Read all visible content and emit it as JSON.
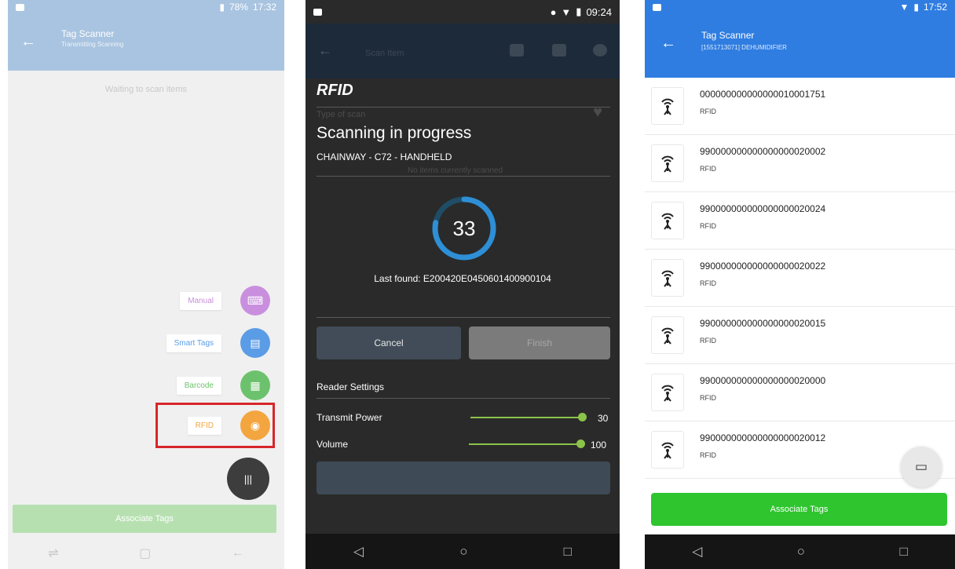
{
  "colors": {
    "p1_header": "#a9c4e0",
    "p3_header": "#2f7de1",
    "green": "#2ec52e",
    "slider": "#8bc34a",
    "highlight": "#d7262b",
    "manual": "#c98fde",
    "smart_tags": "#5b9ce6",
    "barcode": "#6cc26c",
    "rfid": "#f3a53f"
  },
  "phone1": {
    "status": {
      "battery": "78%",
      "time": "17:32"
    },
    "title": "Tag Scanner",
    "subtitle": "Transmitting Scanning",
    "waiting": "Waiting to scan items",
    "menu": [
      {
        "label": "Manual",
        "icon": "keyboard-icon"
      },
      {
        "label": "Smart Tags",
        "icon": "smart-tag-icon"
      },
      {
        "label": "Barcode",
        "icon": "barcode-icon"
      },
      {
        "label": "RFID",
        "icon": "rfid-icon"
      }
    ],
    "fab_icon_text": "|||",
    "associate": "Associate Tags"
  },
  "phone2": {
    "status": {
      "time": "09:24"
    },
    "bg_title": "Scan Item",
    "panel_title": "RFID",
    "ghost_type": "Type of scan",
    "ghost_empty": "No items currently scanned",
    "scanning": "Scanning in progress",
    "device": "CHAINWAY - C72 - HANDHELD",
    "count": "33",
    "progress": 0.78,
    "last_found": "Last found: E200420E0450601400900104",
    "cancel": "Cancel",
    "finish": "Finish",
    "reader_settings": "Reader Settings",
    "settings": [
      {
        "label": "Transmit Power",
        "value": "30",
        "fraction": 1.0
      },
      {
        "label": "Volume",
        "value": "100",
        "fraction": 1.0
      }
    ]
  },
  "phone3": {
    "status": {
      "time": "17:52"
    },
    "title": "Tag Scanner",
    "subtitle": "[1551713071] DEHUMIDIFIER",
    "items": [
      {
        "id": "000000000000000010001751",
        "type": "RFID"
      },
      {
        "id": "990000000000000000020002",
        "type": "RFID"
      },
      {
        "id": "990000000000000000020024",
        "type": "RFID"
      },
      {
        "id": "990000000000000000020022",
        "type": "RFID"
      },
      {
        "id": "990000000000000000020015",
        "type": "RFID"
      },
      {
        "id": "990000000000000000020000",
        "type": "RFID"
      },
      {
        "id": "990000000000000000020012",
        "type": "RFID"
      }
    ],
    "associate": "Associate Tags"
  },
  "nav": {
    "back": "◁",
    "home": "○",
    "recent": "□"
  }
}
